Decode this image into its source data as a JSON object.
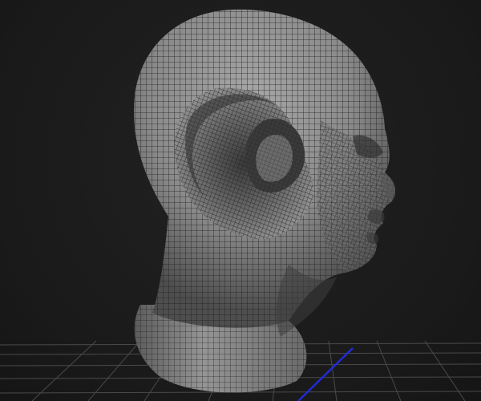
{
  "viewport": {
    "background_color": "#1c1c1c",
    "mesh_fill_color": "#8f8f8f",
    "mesh_wire_color": "#1e1e1e",
    "floor_grid_color": "#4a4a4a",
    "axis_color": "#1f2bd6",
    "model_icon": "sculpt-head-mesh-icon",
    "axis_icon": "z-axis-line-icon"
  }
}
